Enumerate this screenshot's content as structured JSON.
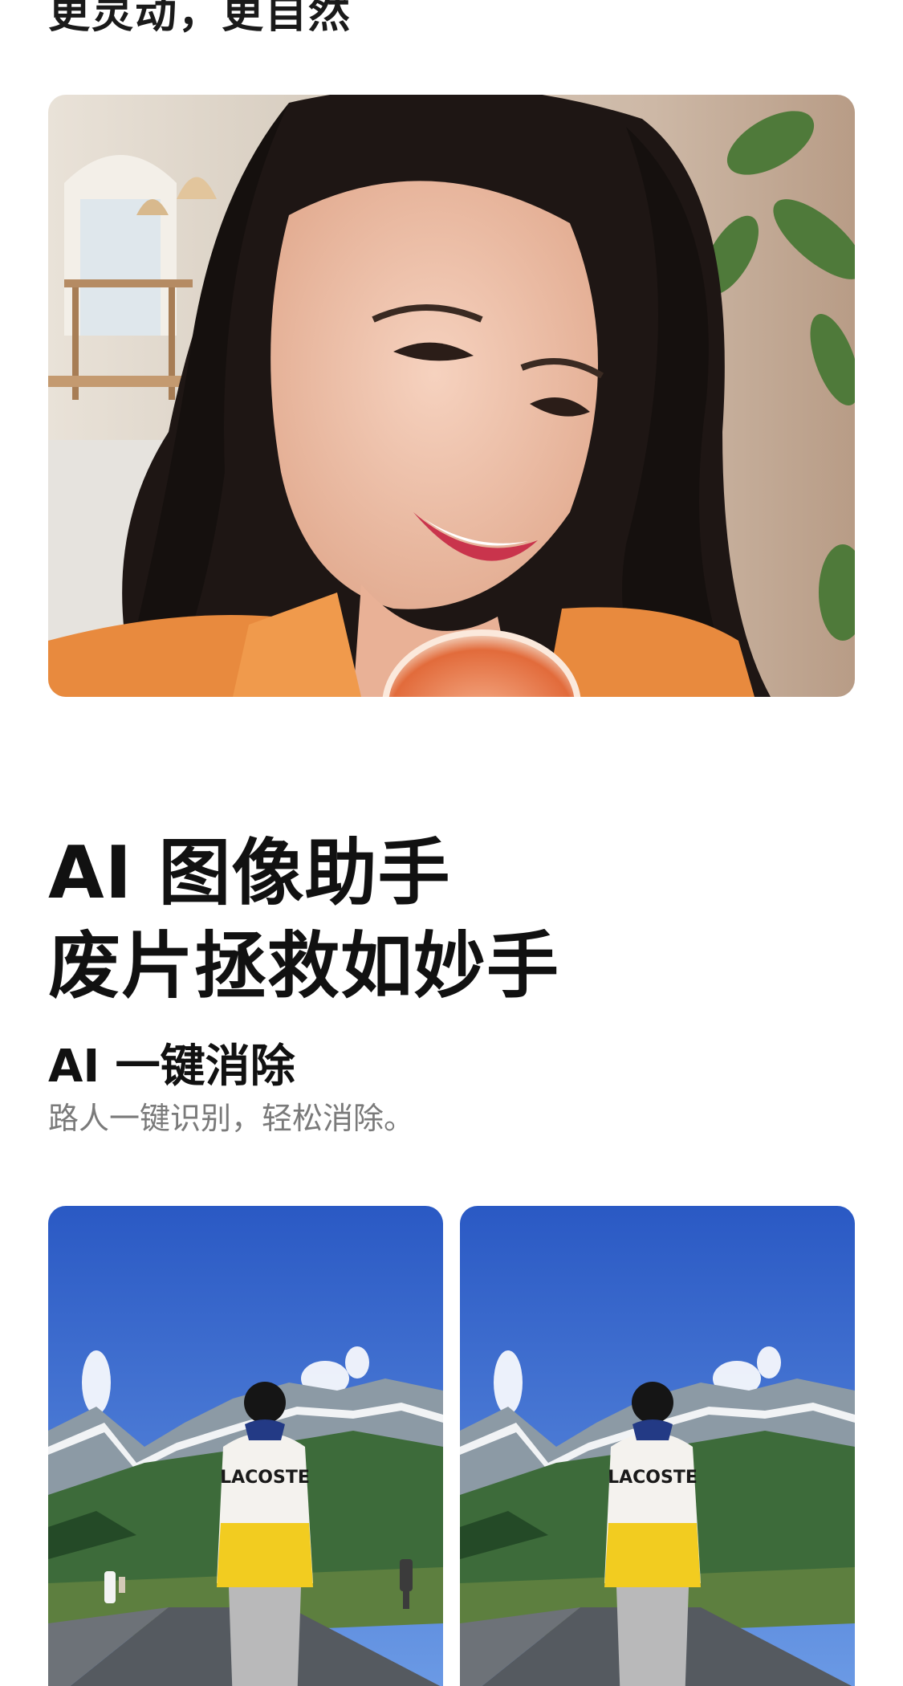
{
  "top_section": {
    "heading": "更灵动，更自然"
  },
  "ai_section": {
    "title_lines": [
      "AI 图像助手",
      "废片拯救如妙手"
    ],
    "feature": {
      "title": "AI 一键消除",
      "description": "路人一键识别，轻松消除。"
    }
  },
  "images": {
    "portrait": "selfie-portrait-photo",
    "compare_before": "landscape-with-passersby-photo",
    "compare_after": "landscape-passersby-removed-photo"
  },
  "colors": {
    "text_primary": "#111111",
    "text_secondary": "#7a7a7a",
    "background": "#ffffff"
  }
}
